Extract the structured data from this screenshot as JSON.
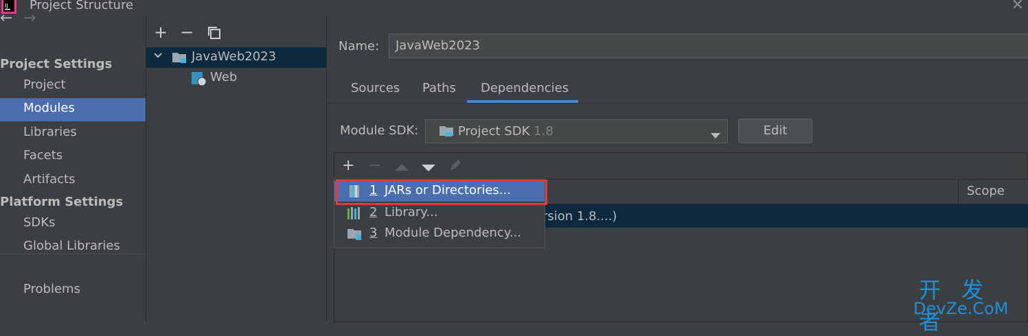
{
  "window": {
    "title": "Project Structure"
  },
  "icons": {
    "back": "←",
    "forward": "→",
    "add": "+",
    "remove": "−",
    "copy": "⧉",
    "close": "✕",
    "up": "▲",
    "down": "▼",
    "edit": "✎",
    "expand": "⌄"
  },
  "nav": {
    "project_settings_heading": "Project Settings",
    "project_settings": [
      {
        "label": "Project",
        "selected": false
      },
      {
        "label": "Modules",
        "selected": true
      },
      {
        "label": "Libraries",
        "selected": false
      },
      {
        "label": "Facets",
        "selected": false
      },
      {
        "label": "Artifacts",
        "selected": false
      }
    ],
    "platform_settings_heading": "Platform Settings",
    "platform_settings": [
      {
        "label": "SDKs"
      },
      {
        "label": "Global Libraries"
      }
    ],
    "problems": "Problems"
  },
  "tree": {
    "root": "JavaWeb2023",
    "child": "Web"
  },
  "module": {
    "name_label": "Name:",
    "name_value": "JavaWeb2023",
    "tabs": [
      {
        "label": "Sources",
        "active": false
      },
      {
        "label": "Paths",
        "active": false
      },
      {
        "label": "Dependencies",
        "active": true
      }
    ],
    "sdk_label": "Module SDK:",
    "sdk_value": "Project SDK",
    "sdk_version": "1.8",
    "edit_button": "Edit",
    "scope_header": "Scope",
    "dependency_row_text": "rsion 1.8....)"
  },
  "popup": {
    "items": [
      {
        "number": "1",
        "label": "JARs or Directories...",
        "selected": true
      },
      {
        "number": "2",
        "label": "Library...",
        "selected": false
      },
      {
        "number": "3",
        "label": "Module Dependency...",
        "selected": false
      }
    ]
  },
  "watermark": {
    "top": "开 发 者",
    "bottom": "DevZe.CoM"
  },
  "colors": {
    "background": "#3c3f41",
    "selection": "#4b6eaf",
    "row_selection": "#0d293e",
    "highlight_border": "#e5393a",
    "tab_underline": "#4a88c7"
  }
}
